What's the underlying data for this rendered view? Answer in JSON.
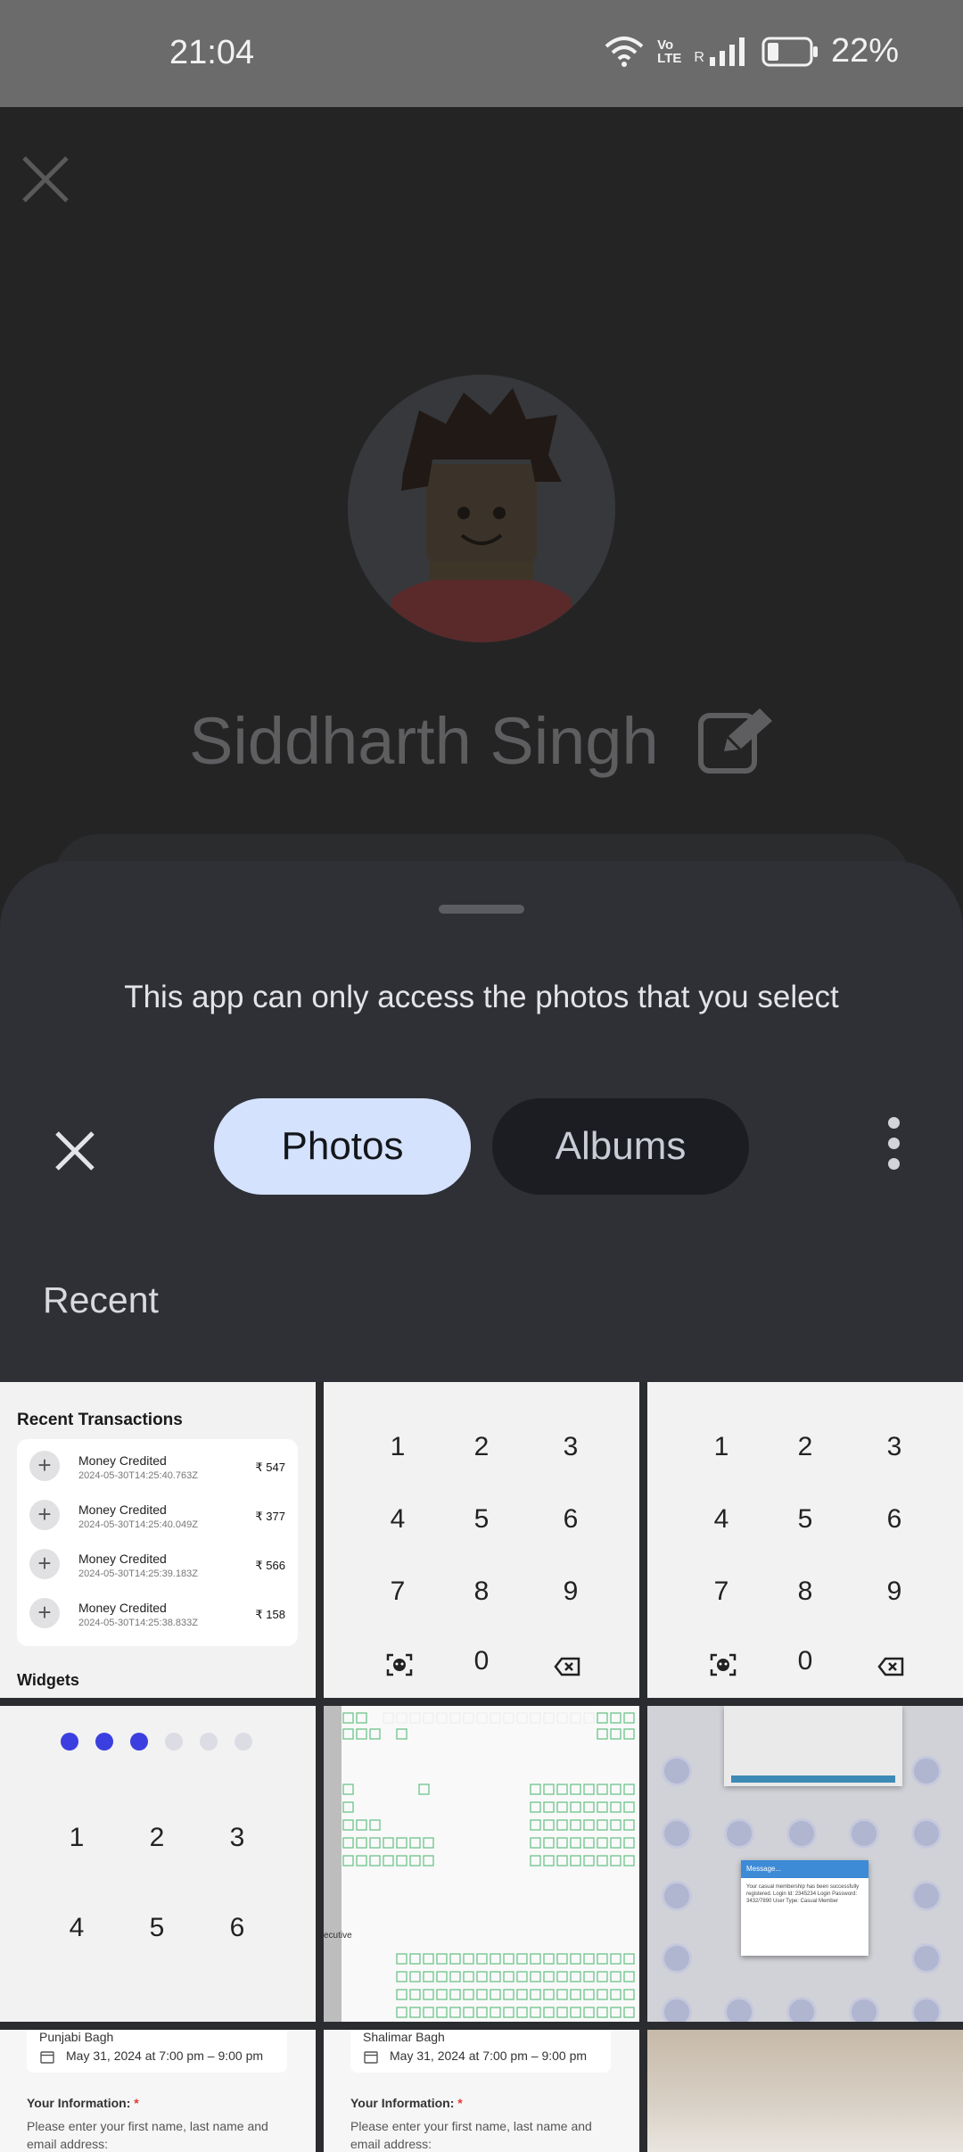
{
  "status_bar": {
    "time": "21:04",
    "network_label_top": "Vo",
    "network_label_bottom": "LTE",
    "roaming": "R",
    "battery": "22%"
  },
  "profile": {
    "name": "Siddharth Singh"
  },
  "picker": {
    "notice": "This app can only access the photos that you select",
    "tabs": [
      {
        "label": "Photos",
        "selected": true
      },
      {
        "label": "Albums",
        "selected": false
      }
    ],
    "section_title": "Recent"
  },
  "thumbnails": {
    "transactions": {
      "title": "Recent Transactions",
      "rows": [
        {
          "label": "Money Credited",
          "date": "2024-05-30T14:25:40.763Z",
          "amount": "₹ 547"
        },
        {
          "label": "Money Credited",
          "date": "2024-05-30T14:25:40.049Z",
          "amount": "₹ 377"
        },
        {
          "label": "Money Credited",
          "date": "2024-05-30T14:25:39.183Z",
          "amount": "₹ 566"
        },
        {
          "label": "Money Credited",
          "date": "2024-05-30T14:25:38.833Z",
          "amount": "₹ 158"
        }
      ],
      "footer": "Widgets"
    },
    "keypad": {
      "keys": [
        "1",
        "2",
        "3",
        "4",
        "5",
        "6",
        "7",
        "8",
        "9",
        "0"
      ]
    },
    "pin_pad": {
      "filled_dots": 3,
      "empty_dots": 3,
      "keys": [
        "1",
        "2",
        "3",
        "4",
        "5",
        "6"
      ],
      "dot_color": "#3b3fe0"
    },
    "seating": {
      "section_label": "ecutive"
    },
    "message_dialog": {
      "title": "Message...",
      "body": "Your casual membership has been successfully registered. Login Id: 2345234 Login Password: 3432/7890 User Type: Casual Member"
    },
    "form_left": {
      "place": "Punjabi Bagh",
      "date": "May 31, 2024 at 7:00 pm – 9:00 pm",
      "heading": "Your Information:",
      "required": "*",
      "instructions": "Please enter your first name, last name and email address:"
    },
    "form_right": {
      "place": "Shalimar Bagh",
      "date": "May 31, 2024 at 7:00 pm – 9:00 pm",
      "heading": "Your Information:",
      "required": "*",
      "instructions": "Please enter your first name, last name and email address:"
    }
  },
  "colors": {
    "status_bar": "#6b6b6b",
    "sheet": "#2f3036",
    "selected_tab": "#d4e2fd",
    "unselected_tab": "#1b1d22"
  }
}
